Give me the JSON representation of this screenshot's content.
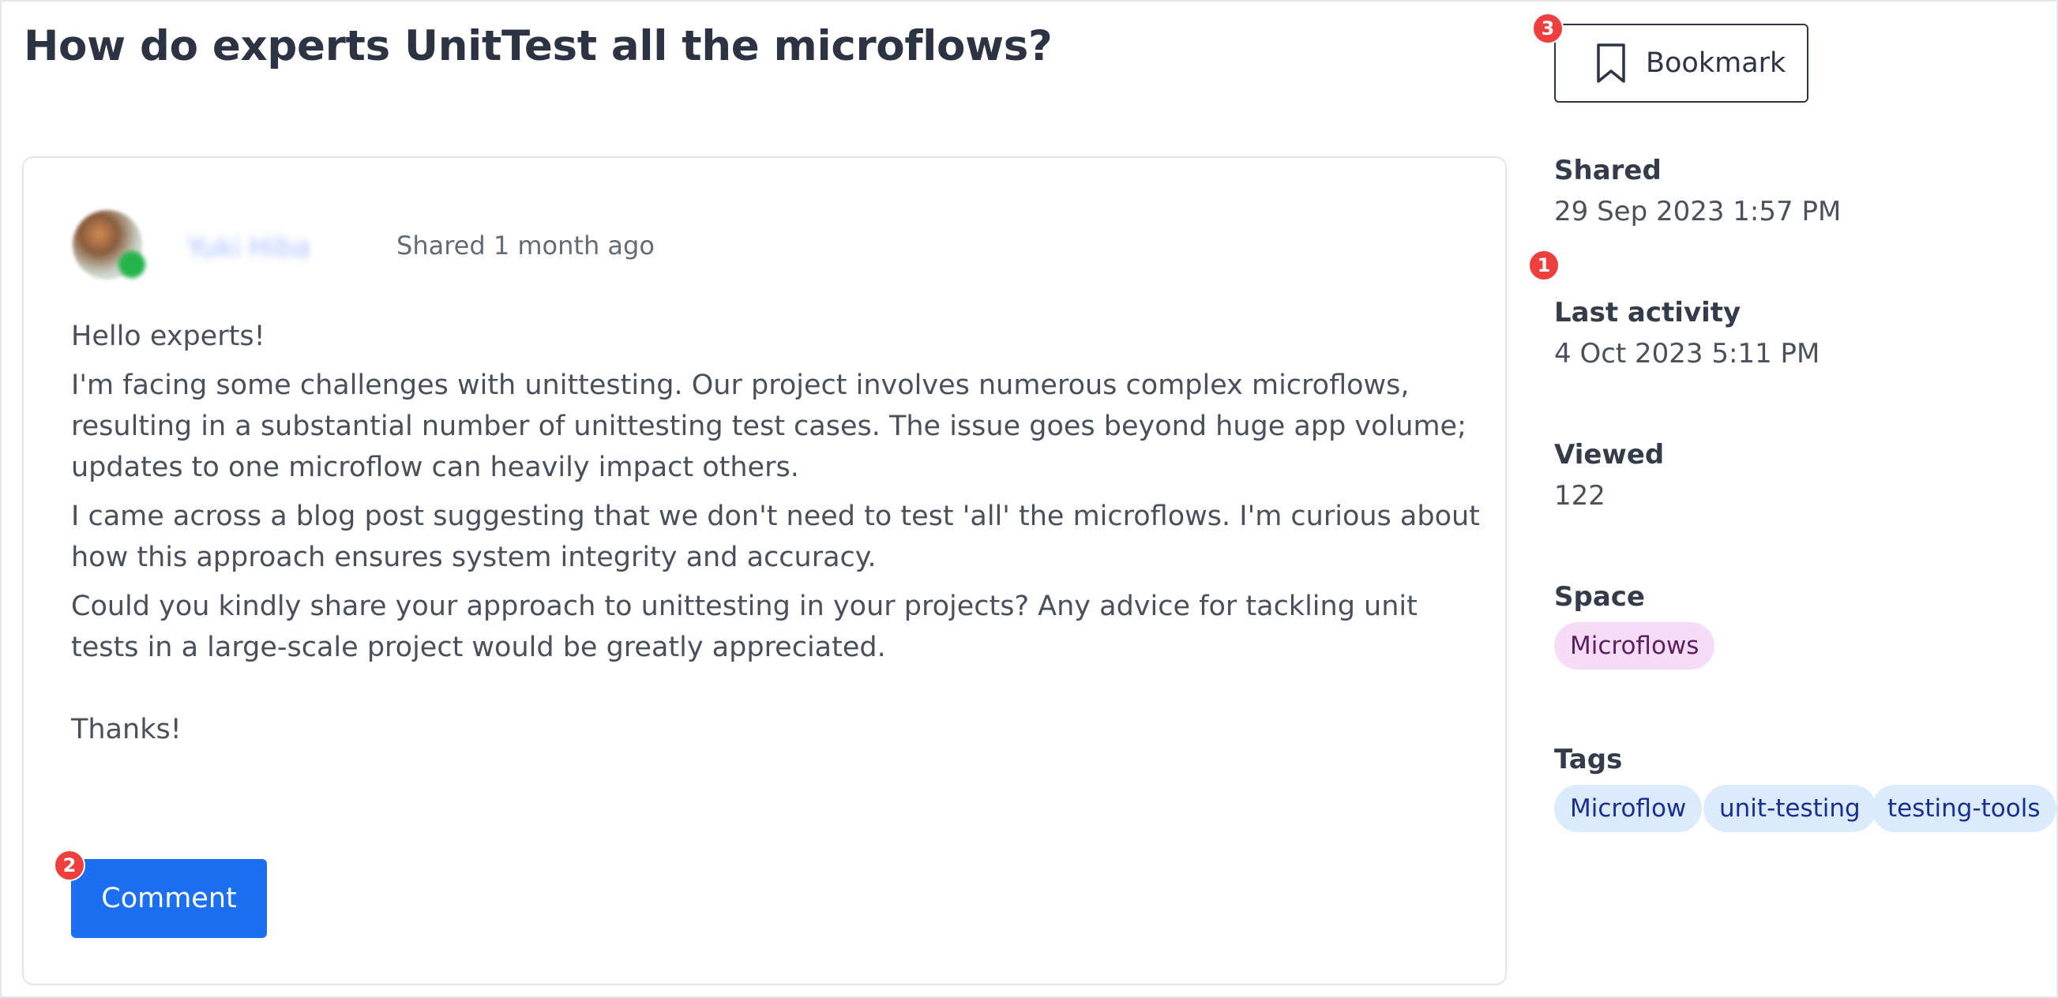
{
  "page": {
    "title": "How do experts UnitTest all the microflows?"
  },
  "post": {
    "author_name": "Yuki Hiba",
    "shared_ago": "Shared 1 month ago",
    "paragraphs": [
      "Hello experts!",
      "I'm facing some challenges with unittesting. Our project involves numerous complex microflows, resulting in a substantial number of unittesting test cases. The issue goes beyond huge app volume; updates to one microflow can heavily impact others.",
      "I came across a blog post suggesting that we don't need to test 'all' the microflows. I'm curious about how this approach ensures system integrity and accuracy.",
      "Could you kindly share your approach to unittesting in your projects? Any advice for tackling unit tests in a large-scale project would be greatly appreciated."
    ],
    "closing": "Thanks!",
    "comment_label": "Comment",
    "comment_color": "#1d6ff2"
  },
  "sidebar": {
    "bookmark_label": "Bookmark",
    "bookmark_icon": "bookmark-icon",
    "shared_label": "Shared",
    "shared_value": "29 Sep 2023 1:57 PM",
    "last_activity_label": "Last activity",
    "last_activity_value": "4 Oct 2023 5:11 PM",
    "viewed_label": "Viewed",
    "viewed_value": "122",
    "space_label": "Space",
    "space_value": "Microflows",
    "tags_label": "Tags",
    "tags": [
      "Microflow",
      "unit-testing",
      "testing-tools"
    ]
  },
  "annotations": {
    "badge_1": "1",
    "badge_2": "2",
    "badge_3": "3",
    "badge_color": "#ee3f3f"
  }
}
